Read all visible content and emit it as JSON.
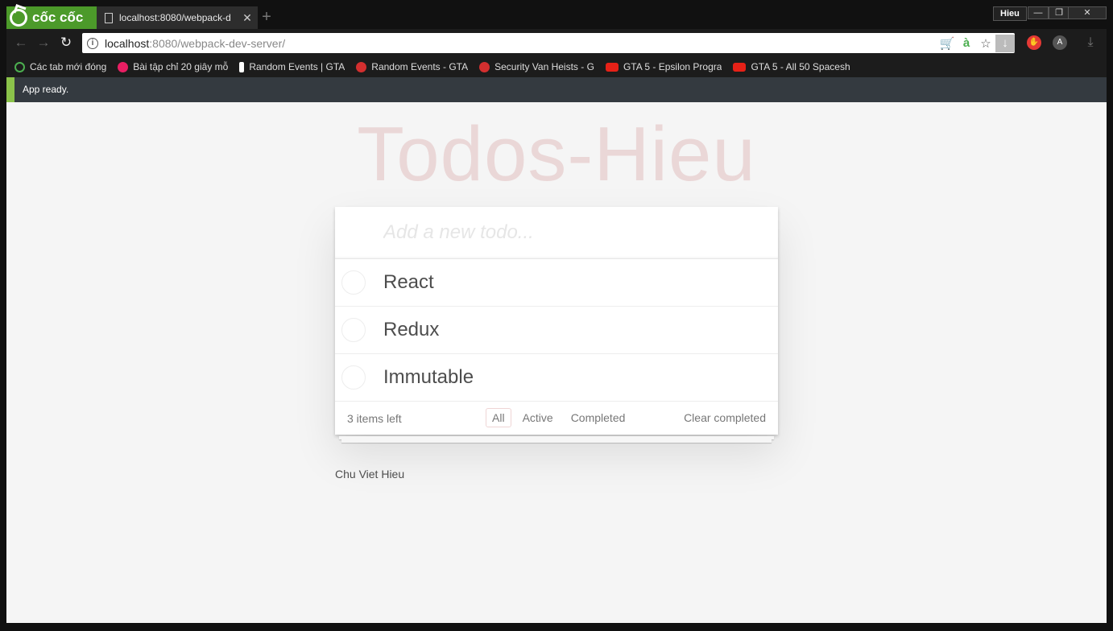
{
  "browser": {
    "brand_name": "cốc cốc",
    "tab_title": "localhost:8080/webpack-d",
    "profile_name": "Hieu",
    "url_host": "localhost",
    "url_rest": ":8080/webpack-dev-server/",
    "win_minimize": "—",
    "win_restore": "❐",
    "win_close": "✕"
  },
  "bookmarks": [
    {
      "label": "Các tab mới đóng",
      "icon": "restore-icon",
      "color": "#4caf50"
    },
    {
      "label": "Bài tập chỉ 20 giây mỗ",
      "icon": "face-icon",
      "color": "#e91e63"
    },
    {
      "label": "Random Events | GTA",
      "icon": "info-icon",
      "color": "#ffffff"
    },
    {
      "label": "Random Events - GTA",
      "icon": "gta-icon",
      "color": "#d32f2f"
    },
    {
      "label": "Security Van Heists - G",
      "icon": "gta-icon",
      "color": "#d32f2f"
    },
    {
      "label": "GTA 5 - Epsilon Progra",
      "icon": "youtube-icon",
      "color": "#e62117"
    },
    {
      "label": "GTA 5 - All 50 Spacesh",
      "icon": "youtube-icon",
      "color": "#e62117"
    }
  ],
  "notification": {
    "text": "App ready."
  },
  "app": {
    "title": "Todos-Hieu",
    "placeholder": "Add a new todo...",
    "todos": [
      {
        "label": "React"
      },
      {
        "label": "Redux"
      },
      {
        "label": "Immutable"
      }
    ],
    "footer": {
      "count": "3 items left",
      "filters": [
        "All",
        "Active",
        "Completed"
      ],
      "selected_filter": "All",
      "clear": "Clear completed"
    },
    "author": "Chu Viet Hieu"
  },
  "colors": {
    "brand_green": "#4c9a2a",
    "notify_accent": "#8bc34a",
    "title_color": "#af2f2f"
  }
}
